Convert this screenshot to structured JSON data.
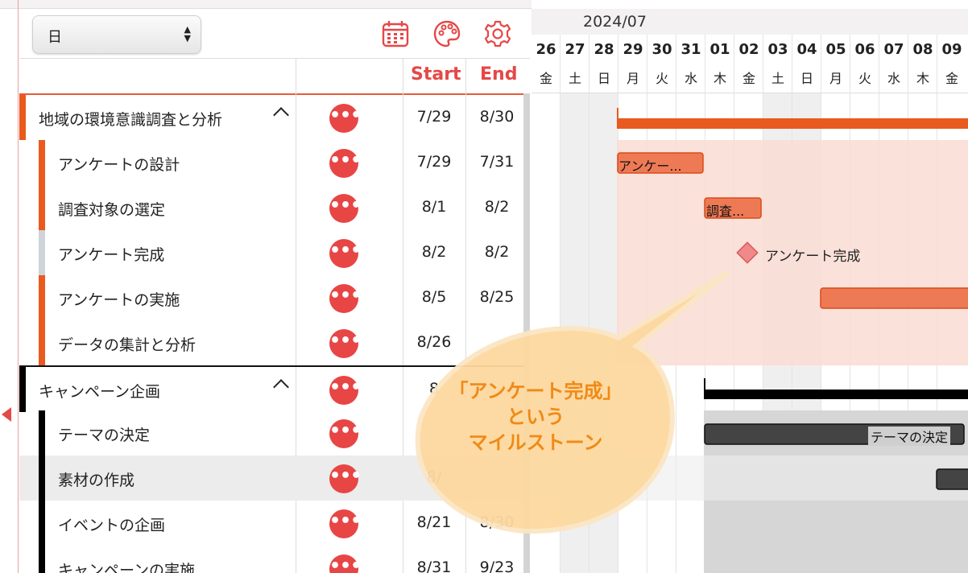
{
  "toolbar": {
    "scale_select": {
      "value": "日",
      "arrows_up": "▲",
      "arrows_down": "▼"
    },
    "icons": [
      "calendar-icon",
      "palette-icon",
      "gear-icon"
    ]
  },
  "grid": {
    "headers": {
      "start": "Start",
      "end": "End"
    },
    "more_glyph": "•••",
    "rows": [
      {
        "name": "地域の環境意識調査と分析",
        "start": "7/29",
        "end": "8/30",
        "group": true
      },
      {
        "name": "アンケートの設計",
        "start": "7/29",
        "end": "7/31"
      },
      {
        "name": "調査対象の選定",
        "start": "8/1",
        "end": "8/2"
      },
      {
        "name": "アンケート完成",
        "start": "8/2",
        "end": "8/2"
      },
      {
        "name": "アンケートの実施",
        "start": "8/5",
        "end": "8/25"
      },
      {
        "name": "データの集計と分析",
        "start": "8/26",
        "end": ""
      },
      {
        "name": "キャンペーン企画",
        "start": "8",
        "end": "",
        "group": true
      },
      {
        "name": "テーマの決定",
        "start": "",
        "end": ""
      },
      {
        "name": "素材の作成",
        "start": "8/",
        "end": ""
      },
      {
        "name": "イベントの企画",
        "start": "8/21",
        "end": "8/30"
      },
      {
        "name": "キャンペーンの実施",
        "start": "8/31",
        "end": "9/23"
      }
    ]
  },
  "timeline": {
    "month": "2024/07",
    "days": [
      {
        "d": "26",
        "w": "金"
      },
      {
        "d": "27",
        "w": "土"
      },
      {
        "d": "28",
        "w": "日"
      },
      {
        "d": "29",
        "w": "月"
      },
      {
        "d": "30",
        "w": "火"
      },
      {
        "d": "31",
        "w": "水"
      },
      {
        "d": "01",
        "w": "木"
      },
      {
        "d": "02",
        "w": "金"
      },
      {
        "d": "03",
        "w": "土"
      },
      {
        "d": "04",
        "w": "日"
      },
      {
        "d": "05",
        "w": "月"
      },
      {
        "d": "06",
        "w": "火"
      },
      {
        "d": "07",
        "w": "水"
      },
      {
        "d": "08",
        "w": "木"
      },
      {
        "d": "09",
        "w": "金"
      }
    ],
    "bar_labels": {
      "survey_design": "アンケー...",
      "target_select": "調査...",
      "theme": "テーマの決定"
    },
    "milestone_label": "アンケート完成"
  },
  "callout": {
    "lines": [
      "「アンケート完成」",
      "という",
      "マイルストーン"
    ]
  },
  "colors": {
    "accent": "#e64747",
    "orange": "#e85a1e",
    "group2": "#000000"
  }
}
